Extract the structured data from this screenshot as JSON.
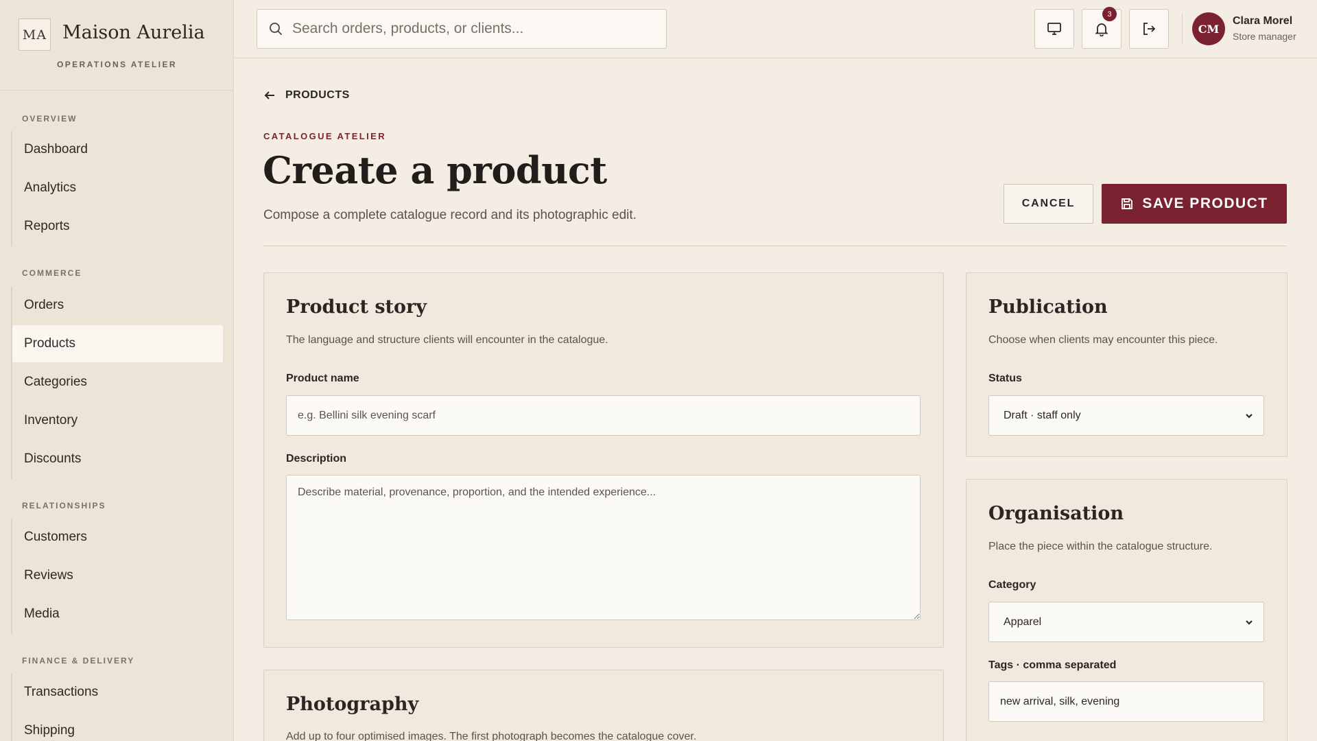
{
  "brand": {
    "mark": "MA",
    "name": "Maison Aurelia",
    "sub": "OPERATIONS ATELIER"
  },
  "nav": {
    "overview_label": "OVERVIEW",
    "overview": [
      "Dashboard",
      "Analytics",
      "Reports"
    ],
    "commerce_label": "COMMERCE",
    "commerce": [
      "Orders",
      "Products",
      "Categories",
      "Inventory",
      "Discounts"
    ],
    "relationships_label": "RELATIONSHIPS",
    "relationships": [
      "Customers",
      "Reviews",
      "Media"
    ],
    "finance_label": "FINANCE & DELIVERY",
    "finance": [
      "Transactions",
      "Shipping"
    ],
    "active": "Products"
  },
  "topbar": {
    "search_placeholder": "Search orders, products, or clients...",
    "notifications_count": "3",
    "user_initials": "CM",
    "user_name": "Clara Morel",
    "user_role": "Store manager"
  },
  "page": {
    "back_label": "PRODUCTS",
    "eyebrow": "CATALOGUE ATELIER",
    "title": "Create a product",
    "subtitle": "Compose a complete catalogue record and its photographic edit.",
    "cancel_label": "CANCEL",
    "save_label": "SAVE PRODUCT"
  },
  "story": {
    "title": "Product story",
    "description": "The language and structure clients will encounter in the catalogue.",
    "name_label": "Product name",
    "name_placeholder": "e.g. Bellini silk evening scarf",
    "desc_label": "Description",
    "desc_placeholder": "Describe material, provenance, proportion, and the intended experience..."
  },
  "photography": {
    "title": "Photography",
    "description": "Add up to four optimised images. The first photograph becomes the catalogue cover."
  },
  "publication": {
    "title": "Publication",
    "description": "Choose when clients may encounter this piece.",
    "status_label": "Status",
    "status_value": "Draft · staff only"
  },
  "organisation": {
    "title": "Organisation",
    "description": "Place the piece within the catalogue structure.",
    "category_label": "Category",
    "category_value": "Apparel",
    "tags_label": "Tags · comma separated",
    "tags_value": "new arrival, silk, evening"
  },
  "colors": {
    "accent": "#7a2230",
    "background": "#f4ede3",
    "sidebar": "#ede4d8"
  }
}
